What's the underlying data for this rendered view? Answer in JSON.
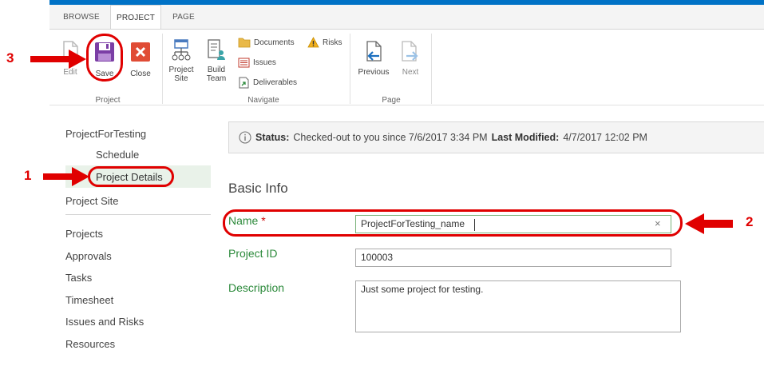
{
  "ribbon": {
    "tabs": [
      "BROWSE",
      "PROJECT",
      "PAGE"
    ],
    "project_group": {
      "label": "Project",
      "edit": "Edit",
      "save": "Save",
      "close": "Close"
    },
    "navigate_group": {
      "label": "Navigate",
      "project_site": "Project\nSite",
      "build_team": "Build\nTeam",
      "documents": "Documents",
      "risks": "Risks",
      "issues": "Issues",
      "deliverables": "Deliverables"
    },
    "page_group": {
      "label": "Page",
      "previous": "Previous",
      "next": "Next"
    }
  },
  "left_nav": {
    "items": [
      "ProjectForTesting",
      "Schedule",
      "Project Details",
      "Project Site",
      "Projects",
      "Approvals",
      "Tasks",
      "Timesheet",
      "Issues and Risks",
      "Resources"
    ]
  },
  "status": {
    "label": "Status:",
    "text": "Checked-out to you since 7/6/2017 3:34 PM",
    "modified_label": "Last Modified:",
    "modified_value": "4/7/2017 12:02 PM"
  },
  "form": {
    "section_title": "Basic Info",
    "name_label": "Name",
    "required_mark": "*",
    "name_value": "ProjectForTesting_name",
    "clear_glyph": "×",
    "id_label": "Project ID",
    "id_value": "100003",
    "description_label": "Description",
    "description_value": "Just some project for testing."
  },
  "annotations": {
    "n1": "1",
    "n2": "2",
    "n3": "3",
    "color": "#e00000"
  },
  "colors": {
    "accent": "#0072c6",
    "label_green": "#2c8a3b",
    "save_purple": "#7b3ea5",
    "close_red": "#e04c35"
  }
}
